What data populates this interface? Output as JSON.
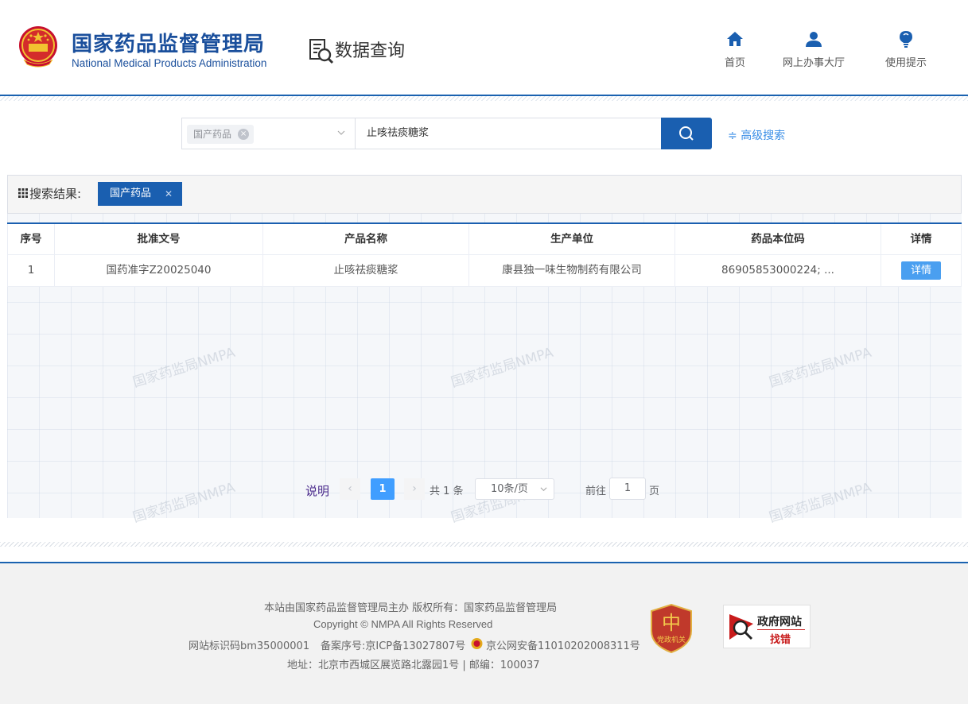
{
  "header": {
    "title": "国家药品监督管理局",
    "subtitle": "National Medical Products Administration",
    "section_title": "数据查询",
    "nav": [
      {
        "label": "首页",
        "icon": "home-icon"
      },
      {
        "label": "网上办事大厅",
        "icon": "user-icon"
      },
      {
        "label": "使用提示",
        "icon": "lightbulb-icon"
      }
    ]
  },
  "search": {
    "category_tag": "国产药品",
    "query": "止咳祛痰糖浆",
    "advanced_label": "高级搜索"
  },
  "results": {
    "label": "搜索结果:",
    "active_tag": "国产药品",
    "columns": [
      "序号",
      "批准文号",
      "产品名称",
      "生产单位",
      "药品本位码",
      "详情"
    ],
    "rows": [
      {
        "index": "1",
        "approval_no": "国药准字Z20025040",
        "product_name": "止咳祛痰糖浆",
        "manufacturer": "康县独一味生物制药有限公司",
        "drug_code": "86905853000224; ...",
        "detail_label": "详情"
      }
    ],
    "watermark": "国家药监局NMPA"
  },
  "pagination": {
    "explain": "说明",
    "current_page": "1",
    "total_text": "共 1 条",
    "page_size": "10条/页",
    "goto_prefix": "前往",
    "goto_value": "1",
    "goto_suffix": "页"
  },
  "footer": {
    "line1": "本站由国家药品监督管理局主办 版权所有：国家药品监督管理局",
    "line2": "Copyright © NMPA All Rights Reserved",
    "site_id": "网站标识码bm35000001",
    "icp": "备案序号:京ICP备13027807号",
    "police": "京公网安备11010202008311号",
    "address": "地址：北京市西城区展览路北露园1号 | 邮编：100037",
    "party_badge_text": "党政机关",
    "gov_badge_line1": "政府网站",
    "gov_badge_line2": "找错"
  },
  "colors": {
    "brand_blue": "#1a5fb0",
    "link_blue": "#3a8ee6",
    "button_blue": "#409eff"
  }
}
